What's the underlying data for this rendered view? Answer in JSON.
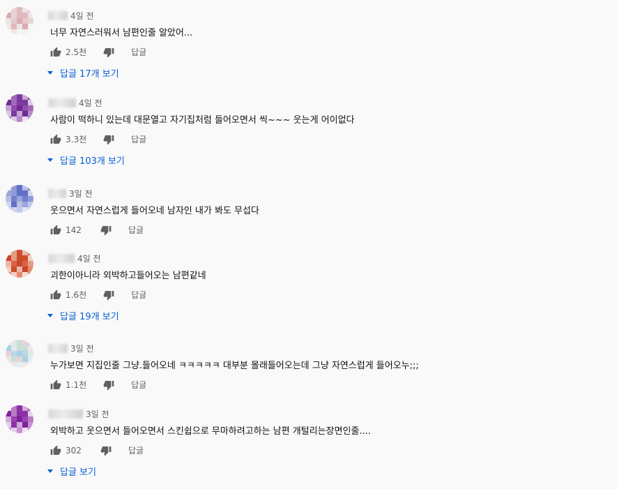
{
  "comments": [
    {
      "time": "4일 전",
      "text": "너무 자연스러워서 남편인줄 알았어...",
      "likes": "2.5천",
      "reply_label": "답글",
      "view_replies": "답글 17개 보기",
      "avatar_colors": [
        "#f2f2f2",
        "#e8d4d6",
        "#dfb9bd",
        "#efe4e5",
        "#e6c9cd",
        "#d9acb2",
        "#f0e6e7",
        "#f5f5f5"
      ]
    },
    {
      "time": "4일 전",
      "text": "사람이 떡하니 있는데 대문열고 자기집처럼 들어오면서 씩~~~ 웃는게 어이없다",
      "likes": "3.3천",
      "reply_label": "답글",
      "view_replies": "답글 103개 보기",
      "avatar_colors": [
        "#ecdff0",
        "#a46ab5",
        "#7b39a0",
        "#c7a3d2",
        "#8e4cac",
        "#6e2a95",
        "#dac7e2",
        "#b78ac8"
      ]
    },
    {
      "time": "3일 전",
      "text": "웃으면서 자연스럽게 들어오네  남자인 내가 봐도 무섭다",
      "likes": "142",
      "reply_label": "답글",
      "view_replies": "",
      "avatar_colors": [
        "#e3e6f5",
        "#8f9ad6",
        "#6170c4",
        "#b8c0e6",
        "#7480cc",
        "#9aa5dc",
        "#d0d5ef",
        "#c2c8eb"
      ]
    },
    {
      "time": "4일 전",
      "text": "괴한이아니라  외박하고들어오는 남편같네",
      "likes": "1.6천",
      "reply_label": "답글",
      "view_replies": "답글 19개 보기",
      "avatar_colors": [
        "#f3ddd6",
        "#e39c85",
        "#cf4d2a",
        "#eab8a8",
        "#d96443",
        "#c9452a",
        "#f1d0c6",
        "#e58b6f"
      ]
    },
    {
      "time": "3일 전",
      "text": "누가보면 지집인줄 그냥.들어오네 ㅋㅋㅋㅋㅋ 대부분 몰래들어오는데 그냥 자연스럽게 들어오누;;;",
      "likes": "1.1천",
      "reply_label": "답글",
      "view_replies": "",
      "avatar_colors": [
        "#f2e6e6",
        "#dfe9e6",
        "#c9dfd8",
        "#e9d3d6",
        "#b9d8e8",
        "#a8cfe3",
        "#f0e4e8",
        "#e3eef0"
      ]
    },
    {
      "time": "3일 전",
      "text": "외박하고 웃으면서 들어오면서 스킨쉽으로 무마하려고하는 남편 개털리는장면인줄....",
      "likes": "302",
      "reply_label": "답글",
      "view_replies": "답글 보기",
      "avatar_colors": [
        "#f0e3f0",
        "#b87cc4",
        "#8a2fa4",
        "#d1a9da",
        "#9a41b1",
        "#7c239a",
        "#e3cfe8",
        "#c58fd0"
      ]
    }
  ],
  "icons": {
    "like": "thumb-up-icon",
    "dislike": "thumb-down-icon",
    "expand": "caret-down-icon"
  }
}
